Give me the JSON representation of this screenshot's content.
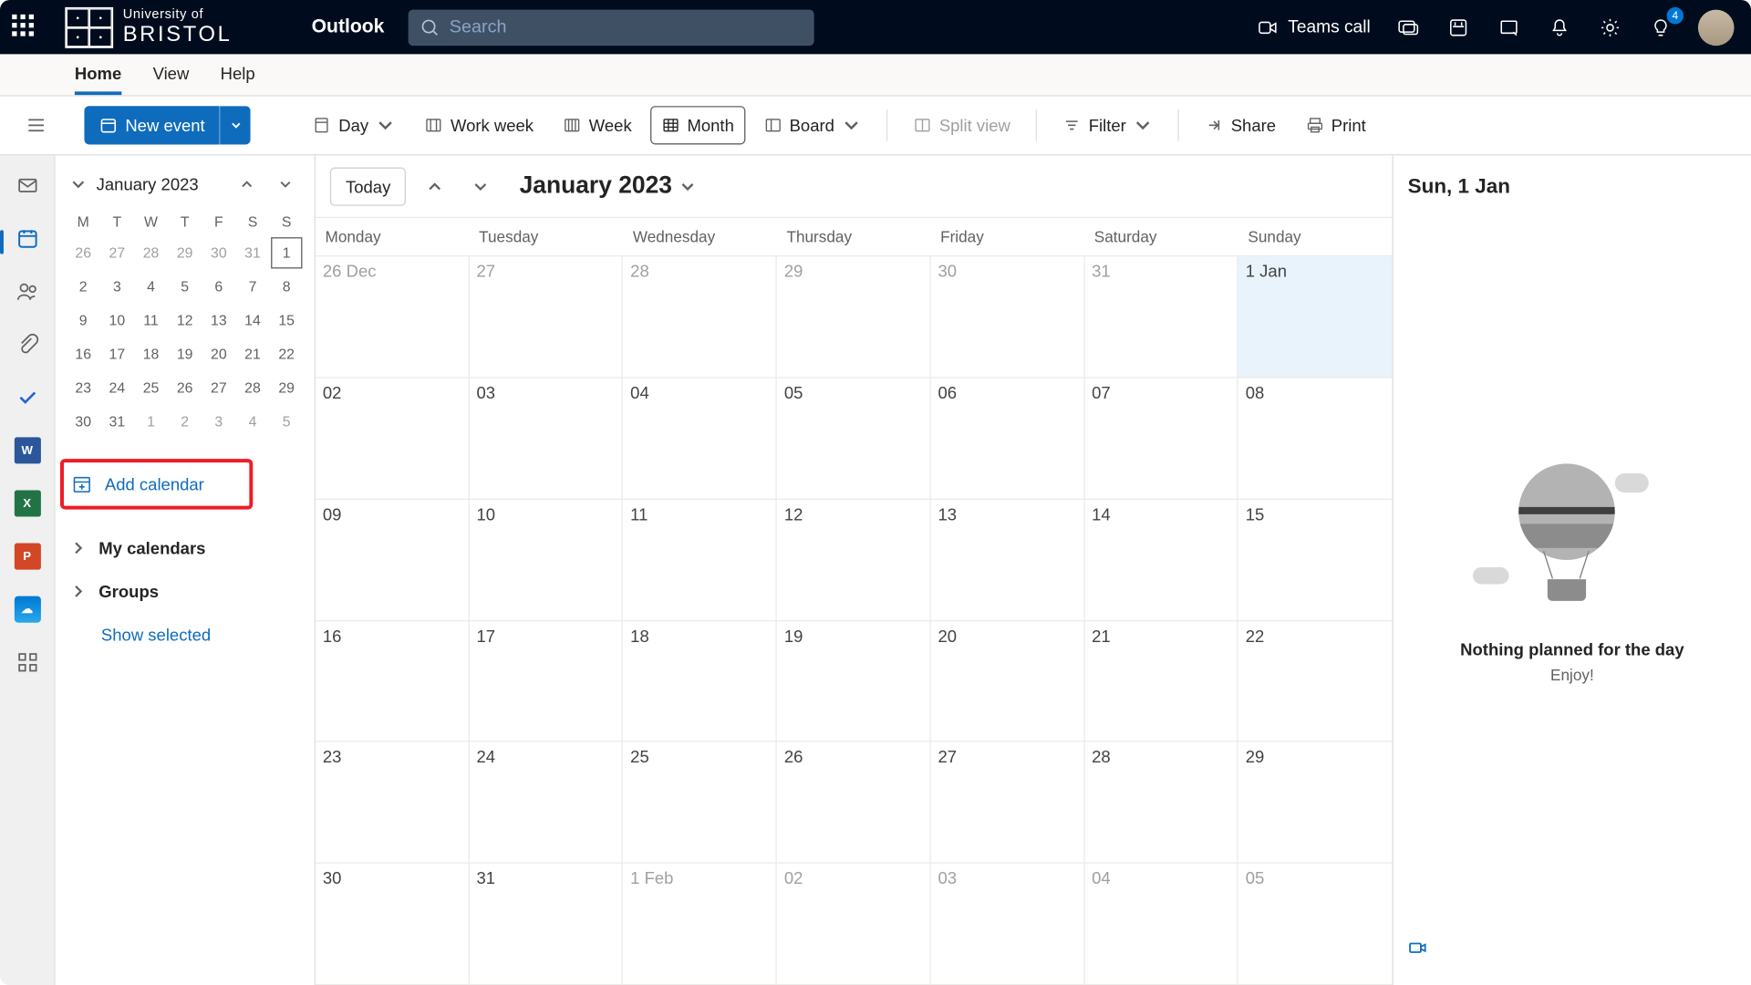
{
  "topbar": {
    "org_line1": "University of",
    "org_line2": "BRISTOL",
    "app_name": "Outlook",
    "search_placeholder": "Search",
    "teams_call": "Teams call",
    "notif_badge": "4"
  },
  "ribbon": {
    "tabs": [
      "Home",
      "View",
      "Help"
    ],
    "active": 0
  },
  "toolbar": {
    "new_event": "New event",
    "views": {
      "day": "Day",
      "work_week": "Work week",
      "week": "Week",
      "month": "Month",
      "board": "Board",
      "split": "Split view"
    },
    "filter": "Filter",
    "share": "Share",
    "print": "Print",
    "active_view": "month"
  },
  "mini_cal": {
    "title": "January 2023",
    "dow": [
      "M",
      "T",
      "W",
      "T",
      "F",
      "S",
      "S"
    ],
    "weeks": [
      [
        {
          "n": "26",
          "o": 1
        },
        {
          "n": "27",
          "o": 1
        },
        {
          "n": "28",
          "o": 1
        },
        {
          "n": "29",
          "o": 1
        },
        {
          "n": "30",
          "o": 1
        },
        {
          "n": "31",
          "o": 1
        },
        {
          "n": "1",
          "s": 1
        }
      ],
      [
        {
          "n": "2"
        },
        {
          "n": "3"
        },
        {
          "n": "4"
        },
        {
          "n": "5"
        },
        {
          "n": "6"
        },
        {
          "n": "7"
        },
        {
          "n": "8"
        }
      ],
      [
        {
          "n": "9"
        },
        {
          "n": "10"
        },
        {
          "n": "11"
        },
        {
          "n": "12"
        },
        {
          "n": "13"
        },
        {
          "n": "14"
        },
        {
          "n": "15"
        }
      ],
      [
        {
          "n": "16"
        },
        {
          "n": "17"
        },
        {
          "n": "18"
        },
        {
          "n": "19"
        },
        {
          "n": "20"
        },
        {
          "n": "21"
        },
        {
          "n": "22"
        }
      ],
      [
        {
          "n": "23"
        },
        {
          "n": "24"
        },
        {
          "n": "25"
        },
        {
          "n": "26"
        },
        {
          "n": "27"
        },
        {
          "n": "28"
        },
        {
          "n": "29"
        }
      ],
      [
        {
          "n": "30"
        },
        {
          "n": "31"
        },
        {
          "n": "1",
          "o": 1
        },
        {
          "n": "2",
          "o": 1
        },
        {
          "n": "3",
          "o": 1
        },
        {
          "n": "4",
          "o": 1
        },
        {
          "n": "5",
          "o": 1
        }
      ]
    ]
  },
  "sidebar": {
    "add_calendar": "Add calendar",
    "my_calendars": "My calendars",
    "groups": "Groups",
    "show_selected": "Show selected"
  },
  "calendar_main": {
    "today": "Today",
    "title": "January 2023",
    "day_headers": [
      "Monday",
      "Tuesday",
      "Wednesday",
      "Thursday",
      "Friday",
      "Saturday",
      "Sunday"
    ],
    "weeks": [
      [
        {
          "l": "26 Dec",
          "o": 1
        },
        {
          "l": "27",
          "o": 1
        },
        {
          "l": "28",
          "o": 1
        },
        {
          "l": "29",
          "o": 1
        },
        {
          "l": "30",
          "o": 1
        },
        {
          "l": "31",
          "o": 1
        },
        {
          "l": "1 Jan",
          "s": 1
        }
      ],
      [
        {
          "l": "02"
        },
        {
          "l": "03"
        },
        {
          "l": "04"
        },
        {
          "l": "05"
        },
        {
          "l": "06"
        },
        {
          "l": "07"
        },
        {
          "l": "08"
        }
      ],
      [
        {
          "l": "09"
        },
        {
          "l": "10"
        },
        {
          "l": "11"
        },
        {
          "l": "12"
        },
        {
          "l": "13"
        },
        {
          "l": "14"
        },
        {
          "l": "15"
        }
      ],
      [
        {
          "l": "16"
        },
        {
          "l": "17"
        },
        {
          "l": "18"
        },
        {
          "l": "19"
        },
        {
          "l": "20"
        },
        {
          "l": "21"
        },
        {
          "l": "22"
        }
      ],
      [
        {
          "l": "23"
        },
        {
          "l": "24"
        },
        {
          "l": "25"
        },
        {
          "l": "26"
        },
        {
          "l": "27"
        },
        {
          "l": "28"
        },
        {
          "l": "29"
        }
      ],
      [
        {
          "l": "30"
        },
        {
          "l": "31"
        },
        {
          "l": "1 Feb",
          "o": 1
        },
        {
          "l": "02",
          "o": 1
        },
        {
          "l": "03",
          "o": 1
        },
        {
          "l": "04",
          "o": 1
        },
        {
          "l": "05",
          "o": 1
        }
      ]
    ]
  },
  "right_panel": {
    "title": "Sun, 1 Jan",
    "empty_title": "Nothing planned for the day",
    "empty_sub": "Enjoy!"
  }
}
